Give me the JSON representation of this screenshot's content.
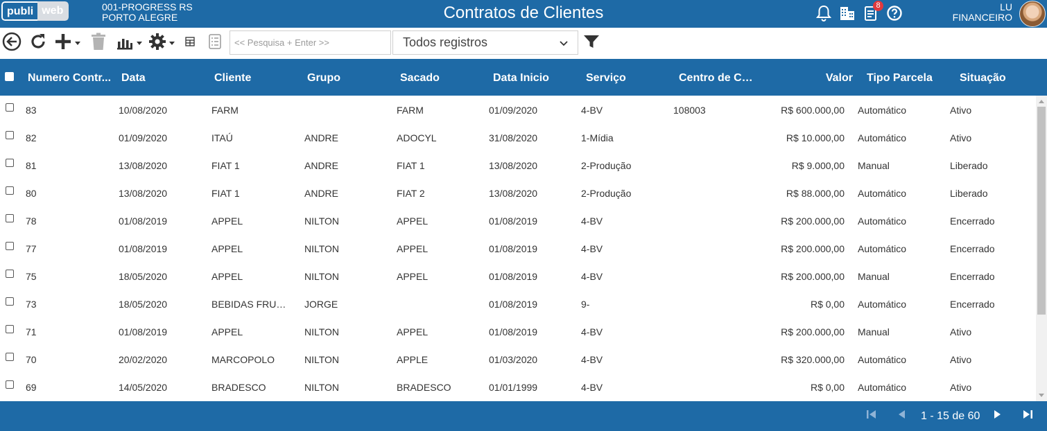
{
  "header": {
    "logo_left": "publi",
    "logo_right": "web",
    "company_line1": "001-PROGRESS RS",
    "company_line2": "PORTO ALEGRE",
    "title": "Contratos de Clientes",
    "notifications_badge": "8",
    "user_name": "LU",
    "user_role": "FINANCEIRO"
  },
  "toolbar": {
    "search_placeholder": "<< Pesquisa + Enter >>",
    "records_filter": "Todos registros"
  },
  "columns": [
    "Numero Contr...",
    "Data",
    "Cliente",
    "Grupo",
    "Sacado",
    "Data Inicio",
    "Serviço",
    "Centro de Cus...",
    "Valor",
    "Tipo Parcela",
    "Situação"
  ],
  "rows": [
    {
      "numero": "83",
      "data": "10/08/2020",
      "cliente": "FARM",
      "grupo": "",
      "sacado": "FARM",
      "inicio": "01/09/2020",
      "servico": "4-BV",
      "centro": "108003",
      "valor": "R$ 600.000,00",
      "tipo": "Automático",
      "situacao": "Ativo"
    },
    {
      "numero": "82",
      "data": "01/09/2020",
      "cliente": "ITAÚ",
      "grupo": "ANDRE",
      "sacado": "ADOCYL",
      "inicio": "31/08/2020",
      "servico": "1-Mídia",
      "centro": "",
      "valor": "R$ 10.000,00",
      "tipo": "Automático",
      "situacao": "Ativo"
    },
    {
      "numero": "81",
      "data": "13/08/2020",
      "cliente": "FIAT 1",
      "grupo": "ANDRE",
      "sacado": "FIAT 1",
      "inicio": "13/08/2020",
      "servico": "2-Produção",
      "centro": "",
      "valor": "R$ 9.000,00",
      "tipo": "Manual",
      "situacao": "Liberado"
    },
    {
      "numero": "80",
      "data": "13/08/2020",
      "cliente": "FIAT 1",
      "grupo": "ANDRE",
      "sacado": "FIAT 2",
      "inicio": "13/08/2020",
      "servico": "2-Produção",
      "centro": "",
      "valor": "R$ 88.000,00",
      "tipo": "Automático",
      "situacao": "Liberado"
    },
    {
      "numero": "78",
      "data": "01/08/2019",
      "cliente": "APPEL",
      "grupo": "NILTON",
      "sacado": "APPEL",
      "inicio": "01/08/2019",
      "servico": "4-BV",
      "centro": "",
      "valor": "R$ 200.000,00",
      "tipo": "Automático",
      "situacao": "Encerrado"
    },
    {
      "numero": "77",
      "data": "01/08/2019",
      "cliente": "APPEL",
      "grupo": "NILTON",
      "sacado": "APPEL",
      "inicio": "01/08/2019",
      "servico": "4-BV",
      "centro": "",
      "valor": "R$ 200.000,00",
      "tipo": "Automático",
      "situacao": "Encerrado"
    },
    {
      "numero": "75",
      "data": "18/05/2020",
      "cliente": "APPEL",
      "grupo": "NILTON",
      "sacado": "APPEL",
      "inicio": "01/08/2019",
      "servico": "4-BV",
      "centro": "",
      "valor": "R$ 200.000,00",
      "tipo": "Manual",
      "situacao": "Encerrado"
    },
    {
      "numero": "73",
      "data": "18/05/2020",
      "cliente": "BEBIDAS FRUKI ...",
      "grupo": "JORGE",
      "sacado": "",
      "inicio": "01/08/2019",
      "servico": "9-",
      "centro": "",
      "valor": "R$ 0,00",
      "tipo": "Automático",
      "situacao": "Encerrado"
    },
    {
      "numero": "71",
      "data": "01/08/2019",
      "cliente": "APPEL",
      "grupo": "NILTON",
      "sacado": "APPEL",
      "inicio": "01/08/2019",
      "servico": "4-BV",
      "centro": "",
      "valor": "R$ 200.000,00",
      "tipo": "Manual",
      "situacao": "Ativo"
    },
    {
      "numero": "70",
      "data": "20/02/2020",
      "cliente": "MARCOPOLO",
      "grupo": "NILTON",
      "sacado": "APPLE",
      "inicio": "01/03/2020",
      "servico": "4-BV",
      "centro": "",
      "valor": "R$ 320.000,00",
      "tipo": "Automático",
      "situacao": "Ativo"
    },
    {
      "numero": "69",
      "data": "14/05/2020",
      "cliente": "BRADESCO",
      "grupo": "NILTON",
      "sacado": "BRADESCO",
      "inicio": "01/01/1999",
      "servico": "4-BV",
      "centro": "",
      "valor": "R$ 0,00",
      "tipo": "Automático",
      "situacao": "Ativo"
    }
  ],
  "pager": {
    "label": "1 - 15 de 60"
  },
  "colors": {
    "brand": "#1e6aa6",
    "badge": "#e0393e",
    "text": "#333333"
  },
  "icons": [
    "back-icon",
    "refresh-icon",
    "add-icon",
    "trash-icon",
    "chart-icon",
    "gear-icon",
    "grid-icon",
    "list-icon",
    "filter-icon",
    "bell-icon",
    "building-icon",
    "document-icon",
    "help-icon",
    "first-page-icon",
    "previous-page-icon",
    "next-page-icon",
    "last-page-icon"
  ]
}
